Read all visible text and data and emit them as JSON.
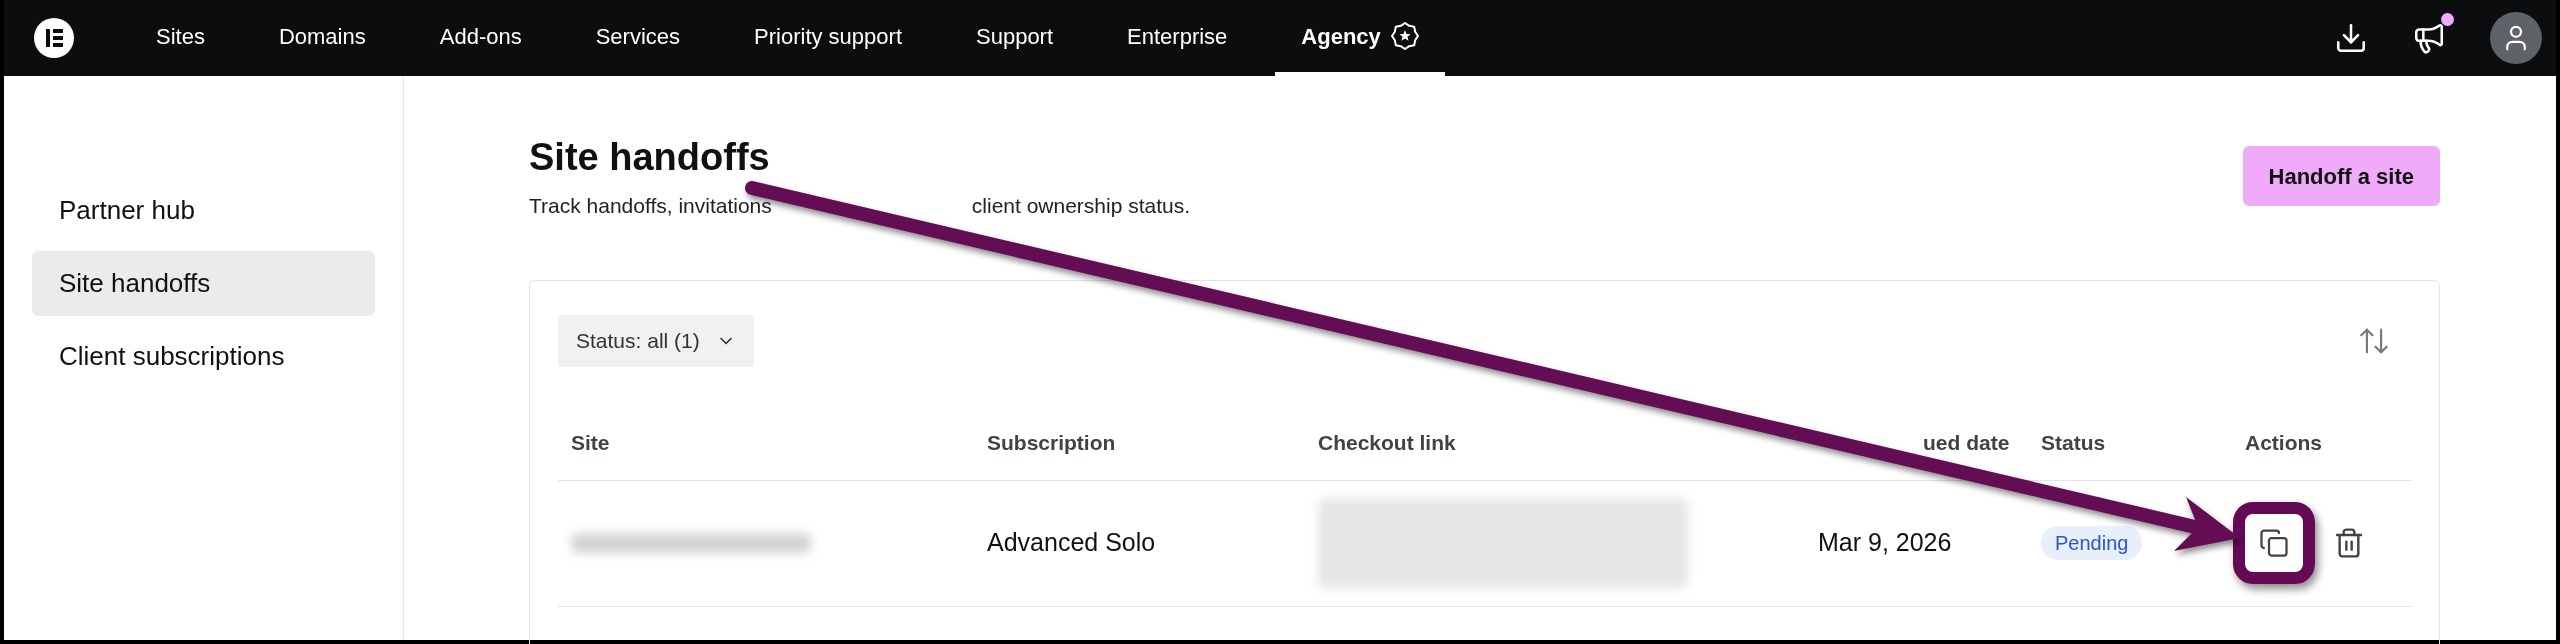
{
  "nav": {
    "items": [
      {
        "label": "Sites",
        "selected": false,
        "badge_icon": false
      },
      {
        "label": "Domains",
        "selected": false,
        "badge_icon": false
      },
      {
        "label": "Add-ons",
        "selected": false,
        "badge_icon": false
      },
      {
        "label": "Services",
        "selected": false,
        "badge_icon": false
      },
      {
        "label": "Priority support",
        "selected": false,
        "badge_icon": false
      },
      {
        "label": "Support",
        "selected": false,
        "badge_icon": false
      },
      {
        "label": "Enterprise",
        "selected": false,
        "badge_icon": false
      },
      {
        "label": "Agency",
        "selected": true,
        "badge_icon": true
      }
    ],
    "notifications_unread": true
  },
  "sidebar": {
    "items": [
      {
        "label": "Partner hub",
        "selected": false
      },
      {
        "label": "Site handoffs",
        "selected": true
      },
      {
        "label": "Client subscriptions",
        "selected": false
      }
    ]
  },
  "page": {
    "title": "Site handoffs",
    "subtitle_parts": [
      "Track handoffs, invitations",
      "client ownership status."
    ],
    "primary_button": "Handoff a site"
  },
  "filter": {
    "label": "Status: all (1)"
  },
  "table": {
    "columns": [
      "Site",
      "Subscription",
      "Checkout link",
      "ued date",
      "Status",
      "Actions"
    ],
    "rows": [
      {
        "subscription": "Advanced Solo",
        "date": "Mar 9, 2026",
        "status": "Pending",
        "highlighted_action": true
      }
    ]
  }
}
